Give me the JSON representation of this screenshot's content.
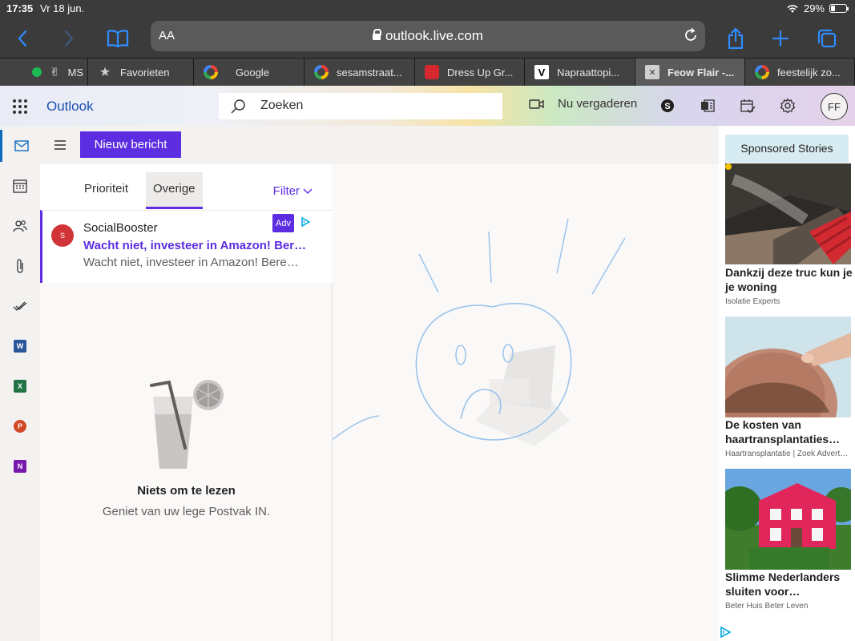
{
  "status": {
    "time": "17:35",
    "date": "Vr 18 jun.",
    "battery": "29%"
  },
  "browser": {
    "text_size": "AA",
    "url": "outlook.live.com",
    "tabs": [
      {
        "label": "MS",
        "icon": "ms-icon"
      },
      {
        "label": "Favorieten",
        "icon": "star-icon"
      },
      {
        "label": "Google",
        "icon": "google-icon"
      },
      {
        "label": "sesamstraat...",
        "icon": "google-icon"
      },
      {
        "label": "Dress Up Gr...",
        "icon": "elmo-icon"
      },
      {
        "label": "Napraattopi...",
        "icon": "v-icon"
      },
      {
        "label": "Feow Flair -...",
        "icon": "close-tab-icon"
      },
      {
        "label": "feestelijk zo...",
        "icon": "google-icon"
      }
    ]
  },
  "header": {
    "app_name": "Outlook",
    "search_placeholder": "Zoeken",
    "meet_now": "Nu vergaderen",
    "avatar_initials": "FF"
  },
  "commands": {
    "new_message": "Nieuw bericht"
  },
  "list": {
    "tabs": [
      "Prioriteit",
      "Overige"
    ],
    "active_tab": "Overige",
    "filter": "Filter",
    "message": {
      "avatar": "S",
      "from": "SocialBooster",
      "subject": "Wacht niet, investeer in Amazon! Bereke...",
      "preview": "Wacht niet, investeer in Amazon! Berek...",
      "badge": "Adv"
    },
    "empty_title": "Niets om te lezen",
    "empty_subtitle": "Geniet van uw lege Postvak IN."
  },
  "ads": {
    "title": "Sponsored Stories",
    "items": [
      {
        "title": "Dankzij deze truc kun je je woning",
        "source": "Isolatie Experts"
      },
      {
        "title": "De kosten van haartransplantaties…",
        "source": "Haartransplantatie | Zoek Advert…"
      },
      {
        "title": "Slimme Nederlanders sluiten voor…",
        "source": "Beter Huis Beter Leven"
      }
    ]
  },
  "colors": {
    "accent": "#5c2de1",
    "brand": "#1a4fb4",
    "safari_blue": "#2f8cff"
  }
}
